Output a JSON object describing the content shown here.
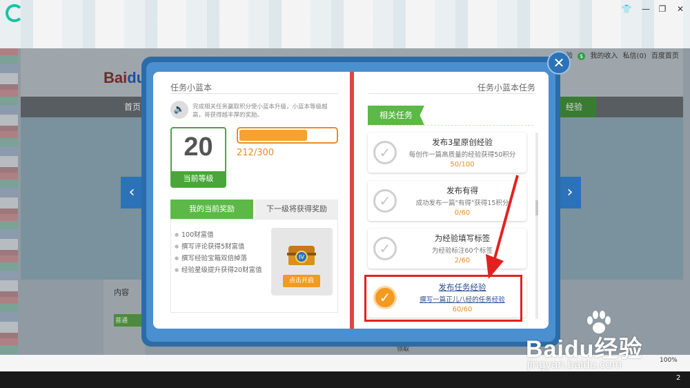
{
  "browser": {
    "zoom": "100%",
    "tray_number": "2"
  },
  "site": {
    "user_links": [
      "的经验",
      "我的收入",
      "私信(0)",
      "百度首页"
    ],
    "nav_home": "首页",
    "nav_jingyan": "经验",
    "content_label": "内容",
    "common_btn": "普通",
    "claim": "领取"
  },
  "book": {
    "left": {
      "title": "任务小蓝本",
      "description": "完成相关任务赢取积分使小蓝本升级，小蓝本等级越高，将获得越丰厚的奖励。",
      "level": "20",
      "level_label": "当前等级",
      "progress_text": "212/300",
      "progress_value": 0.7067,
      "tab_current": "我的当前奖励",
      "tab_next": "下一级将获得奖励",
      "rewards": [
        "100财富值",
        "撰写评论获得5财富值",
        "撰写经验宝箱双倍掉落",
        "经验星级提升获得20财富值"
      ],
      "chest_button": "点击开启",
      "chest_badge": "IV"
    },
    "right": {
      "title": "任务小蓝本任务",
      "section": "相关任务",
      "tasks": [
        {
          "name": "发布3星原创经验",
          "desc": "每创作一篇高质量的经验获得50积分",
          "progress": "50/100",
          "done": false
        },
        {
          "name": "发布有得",
          "desc": "成功发布一篇\"有得\"获得15积分",
          "progress": "0/60",
          "done": false
        },
        {
          "name": "为经验填写标签",
          "desc": "为经验标注60个标签",
          "progress": "2/60",
          "done": false
        },
        {
          "name": "发布任务经验",
          "desc": "撰写一篇正儿八经的任务经验",
          "progress": "60/60",
          "done": true
        }
      ]
    }
  },
  "watermark": {
    "brand": "Baidu经验",
    "url": "jingyan.baidu.com"
  },
  "colors": {
    "green": "#5cb847",
    "orange": "#f39a1f",
    "blue": "#2c72b8",
    "highlight_red": "#e32020"
  }
}
